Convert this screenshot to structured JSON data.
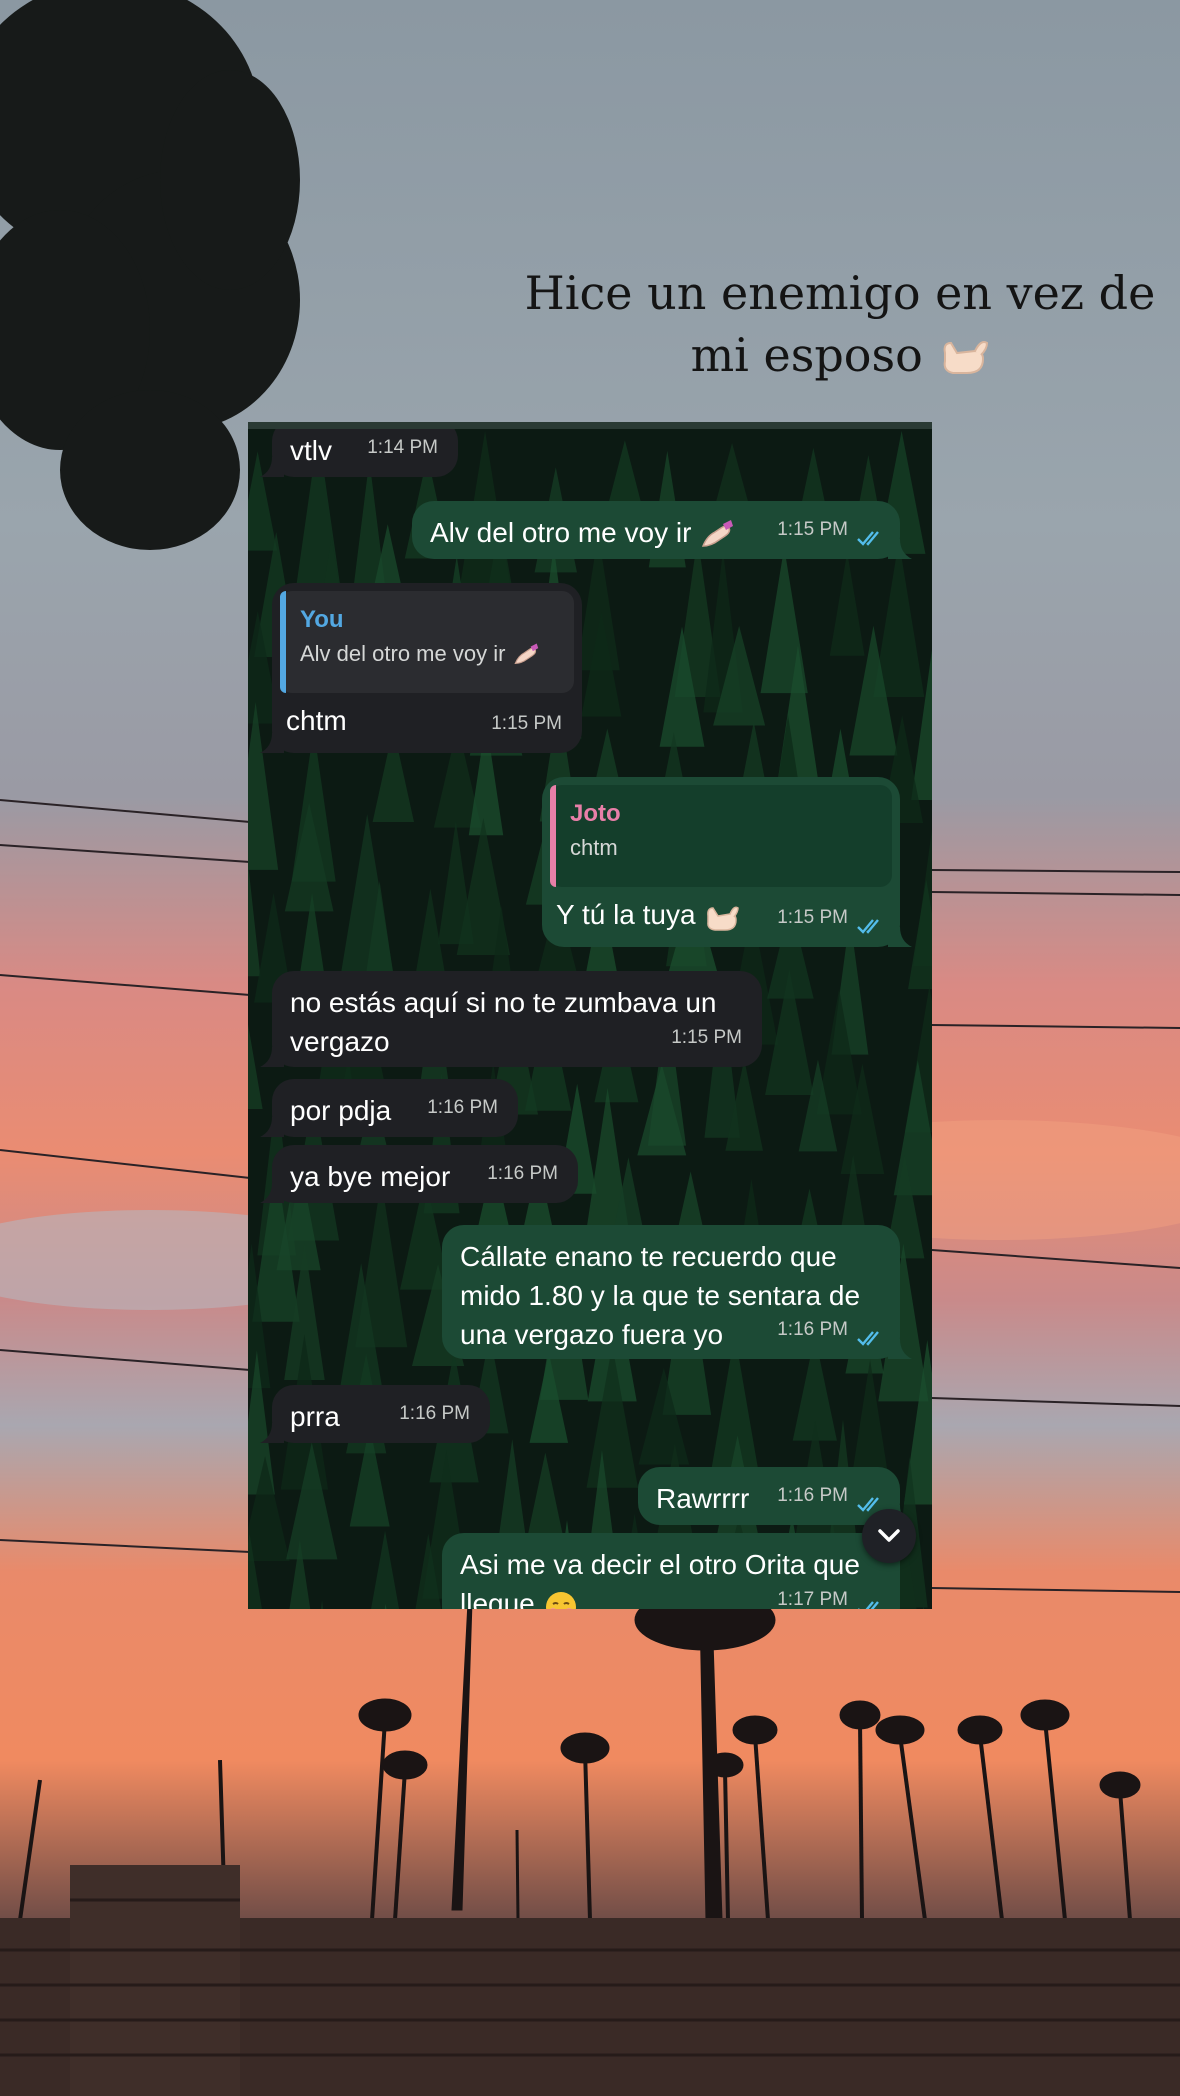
{
  "caption": {
    "line1": "Hice un enemigo en vez de",
    "line2": "mi esposo"
  },
  "colors": {
    "incoming_bubble": "#1f2024",
    "outgoing_bubble": "#1c4a35",
    "read_ticks": "#53bdeb",
    "quote_you": "#53a8e2",
    "quote_joto": "#e87fa8"
  },
  "chat": {
    "messages": [
      {
        "dir": "in",
        "text": "vtlv",
        "time": "1:14 PM"
      },
      {
        "dir": "out",
        "text": "Alv del otro me voy ir",
        "emoji": "nail-polish-icon",
        "time": "1:15 PM",
        "status": "read"
      },
      {
        "dir": "in",
        "quote_author": "You",
        "quote_text": "Alv del otro me voy ir",
        "text": "chtm",
        "time": "1:15 PM"
      },
      {
        "dir": "out",
        "quote_author": "Joto",
        "quote_text": "chtm",
        "text": "Y tú la tuya",
        "emoji": "call-me-hand-icon",
        "time": "1:15 PM",
        "status": "read"
      },
      {
        "dir": "in",
        "text_lines": [
          "no estás aquí si no te zumbava un",
          "vergazo"
        ],
        "time": "1:15 PM"
      },
      {
        "dir": "in",
        "text": "por pdja",
        "time": "1:16 PM"
      },
      {
        "dir": "in",
        "text": "ya bye mejor",
        "time": "1:16 PM"
      },
      {
        "dir": "out",
        "text_lines": [
          "Cállate enano te recuerdo que",
          "mido 1.80 y la que te sentara de",
          "una vergazo fuera yo"
        ],
        "time": "1:16 PM",
        "status": "read"
      },
      {
        "dir": "in",
        "text": "prra",
        "time": "1:16 PM"
      },
      {
        "dir": "out",
        "text": "Rawrrrr",
        "time": "1:16 PM",
        "status": "read"
      },
      {
        "dir": "out",
        "text_lines": [
          "Asi me va decir el otro Orita que",
          "llegue"
        ],
        "emoji": "smiling-face-icon",
        "time": "1:17 PM",
        "status": "read"
      }
    ]
  }
}
